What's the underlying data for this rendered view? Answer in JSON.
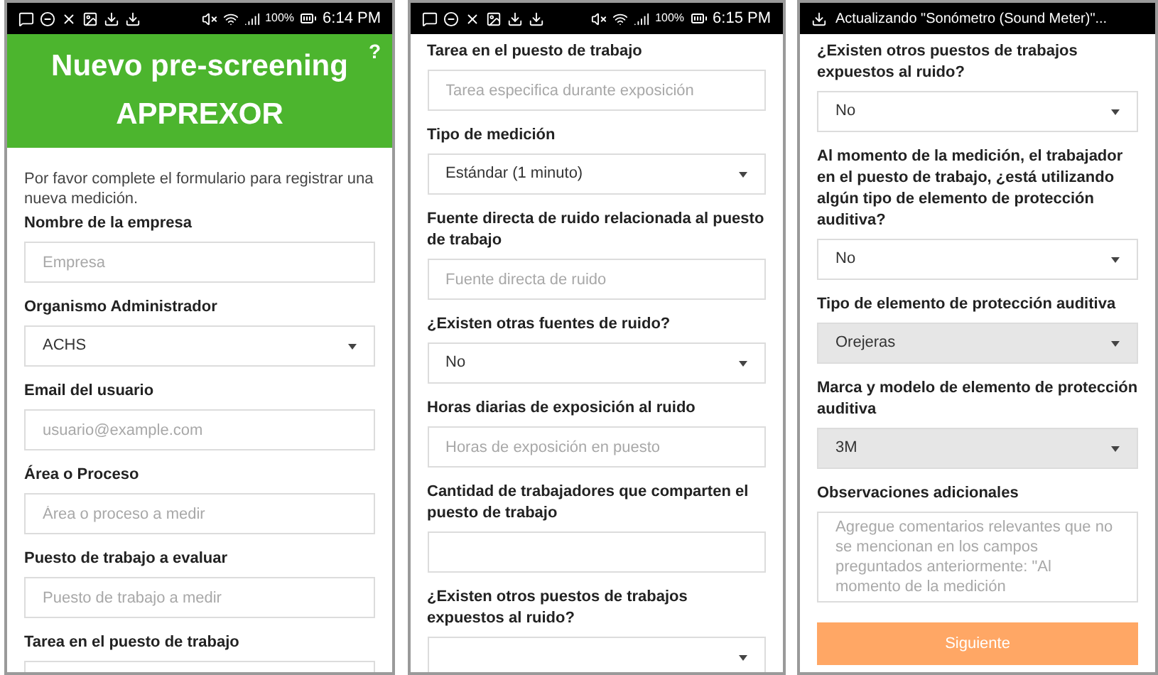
{
  "phones": [
    {
      "status_bar": {
        "kind": "icons",
        "battery": "100%",
        "time": "6:14 PM"
      },
      "header": {
        "title": "Nuevo pre-screening APPREXOR",
        "help": "?"
      },
      "intro": "Por favor complete el formulario para registrar una nueva medición.",
      "fields": [
        {
          "kind": "input",
          "label": "Nombre de la empresa",
          "placeholder": "Empresa"
        },
        {
          "kind": "select",
          "label": "Organismo Administrador",
          "value": "ACHS",
          "disabled": false
        },
        {
          "kind": "input",
          "label": "Email del usuario",
          "placeholder": "usuario@example.com"
        },
        {
          "kind": "input",
          "label": "Área o Proceso",
          "placeholder": "Área o proceso a medir"
        },
        {
          "kind": "input",
          "label": "Puesto de trabajo a evaluar",
          "placeholder": "Puesto de trabajo a medir"
        },
        {
          "kind": "input",
          "label": "Tarea en el puesto de trabajo"
        }
      ]
    },
    {
      "status_bar": {
        "kind": "icons",
        "battery": "100%",
        "time": "6:15 PM"
      },
      "fields": [
        {
          "kind": "input",
          "label": "Tarea en el puesto de trabajo",
          "placeholder": "Tarea especifica durante exposición"
        },
        {
          "kind": "select",
          "label": "Tipo de medición",
          "value": "Estándar (1 minuto)",
          "disabled": false
        },
        {
          "kind": "input",
          "label": "Fuente directa de ruido relacionada al puesto de trabajo",
          "placeholder": "Fuente directa de ruido"
        },
        {
          "kind": "select",
          "label": "¿Existen otras fuentes de ruido?",
          "value": "No",
          "disabled": false
        },
        {
          "kind": "input",
          "label": "Horas diarias de exposición al ruido",
          "placeholder": "Horas de exposición en puesto"
        },
        {
          "kind": "input",
          "label": "Cantidad de trabajadores que comparten el puesto de trabajo"
        },
        {
          "kind": "select",
          "label": "¿Existen otros puestos de trabajos expuestos al ruido?",
          "disabled": false
        }
      ]
    },
    {
      "status_bar": {
        "kind": "notification",
        "text": "Actualizando \"Sonómetro (Sound Meter)\"..."
      },
      "fields": [
        {
          "kind": "select",
          "label": "¿Existen otros puestos de trabajos expuestos al ruido?",
          "value": "No",
          "disabled": false
        },
        {
          "kind": "select",
          "label": "Al momento de la medición, el trabajador en el puesto de trabajo, ¿está utilizando algún tipo de elemento de protección auditiva?",
          "value": "No",
          "disabled": false
        },
        {
          "kind": "select",
          "label": "Tipo de elemento de protección auditiva",
          "value": "Orejeras",
          "disabled": true
        },
        {
          "kind": "select",
          "label": "Marca y modelo de elemento de protección auditiva",
          "value": "3M",
          "disabled": true
        },
        {
          "kind": "textarea",
          "label": "Observaciones adicionales",
          "placeholder": "Agregue comentarios relevantes que no se mencionan en los campos preguntados anteriormente: \"Al momento de la medición"
        }
      ],
      "button": "Siguiente"
    }
  ]
}
